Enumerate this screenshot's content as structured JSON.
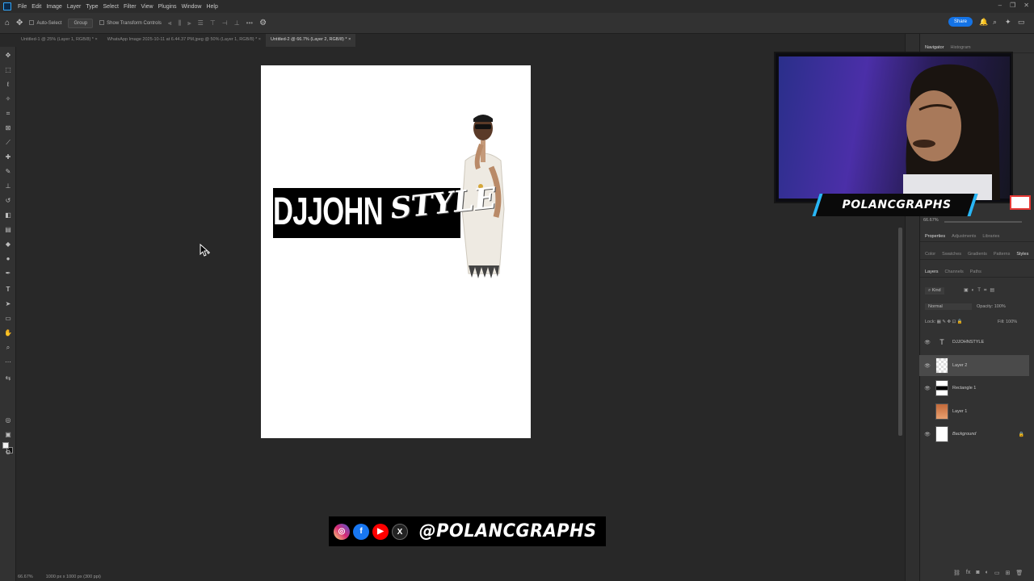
{
  "menu": {
    "items": [
      "File",
      "Edit",
      "Image",
      "Layer",
      "Type",
      "Select",
      "Filter",
      "View",
      "Plugins",
      "Window",
      "Help"
    ]
  },
  "options_bar": {
    "auto_select_label": "Auto-Select",
    "group_value": "Group",
    "transform_label": "Show Transform Controls",
    "share_label": "Share"
  },
  "tabs": [
    {
      "label": "Untitled-1 @ 25% (Layer 1, RGB/8) *",
      "active": false
    },
    {
      "label": "WhatsApp Image 2025-10-11 at 6.44.37 PM.jpeg @ 50% (Layer 1, RGB/8) *",
      "active": false
    },
    {
      "label": "Untitled-2 @ 66.7% (Layer 2, RGB/8) *",
      "active": true
    }
  ],
  "canvas": {
    "title_main": "DJJOHN",
    "title_script": "STYLE"
  },
  "social": {
    "handle": "@POLANCGRAPHS",
    "icons": [
      "instagram-icon",
      "facebook-icon",
      "youtube-icon",
      "x-icon"
    ]
  },
  "status": {
    "zoom": "66.67%",
    "doc_info": "1000 px x 1000 px (300 ppi)"
  },
  "webcam": {
    "brand": "POLANCGRAPHS"
  },
  "panels": {
    "top_tabs": [
      "Navigator",
      "Histogram"
    ],
    "props_tabs": [
      "Properties",
      "Adjustments",
      "Libraries"
    ],
    "color_tabs": [
      "Color",
      "Swatches",
      "Gradients",
      "Patterns",
      "Styles"
    ],
    "layer_tabs": [
      "Layers",
      "Channels",
      "Paths"
    ],
    "kind_label": "Kind",
    "blend_mode": "Normal",
    "opacity_label": "Opacity:",
    "opacity_value": "100%",
    "lock_label": "Lock:",
    "fill_label": "Fill:",
    "fill_value": "100%",
    "nav_zoom": "66.67%"
  },
  "layers": [
    {
      "name": "DJJOHNSTYLE",
      "type": "text",
      "visible": true,
      "selected": false
    },
    {
      "name": "Layer 2",
      "type": "pixel",
      "visible": true,
      "selected": true
    },
    {
      "name": "Rectangle 1",
      "type": "shape",
      "visible": true,
      "selected": false
    },
    {
      "name": "Layer 1",
      "type": "pixel",
      "visible": false,
      "selected": false
    },
    {
      "name": "Background",
      "type": "background",
      "visible": true,
      "selected": false
    }
  ],
  "colors": {
    "accent": "#1473e6",
    "brand_cyan": "#29b6f6",
    "brand_red": "#e53935"
  }
}
